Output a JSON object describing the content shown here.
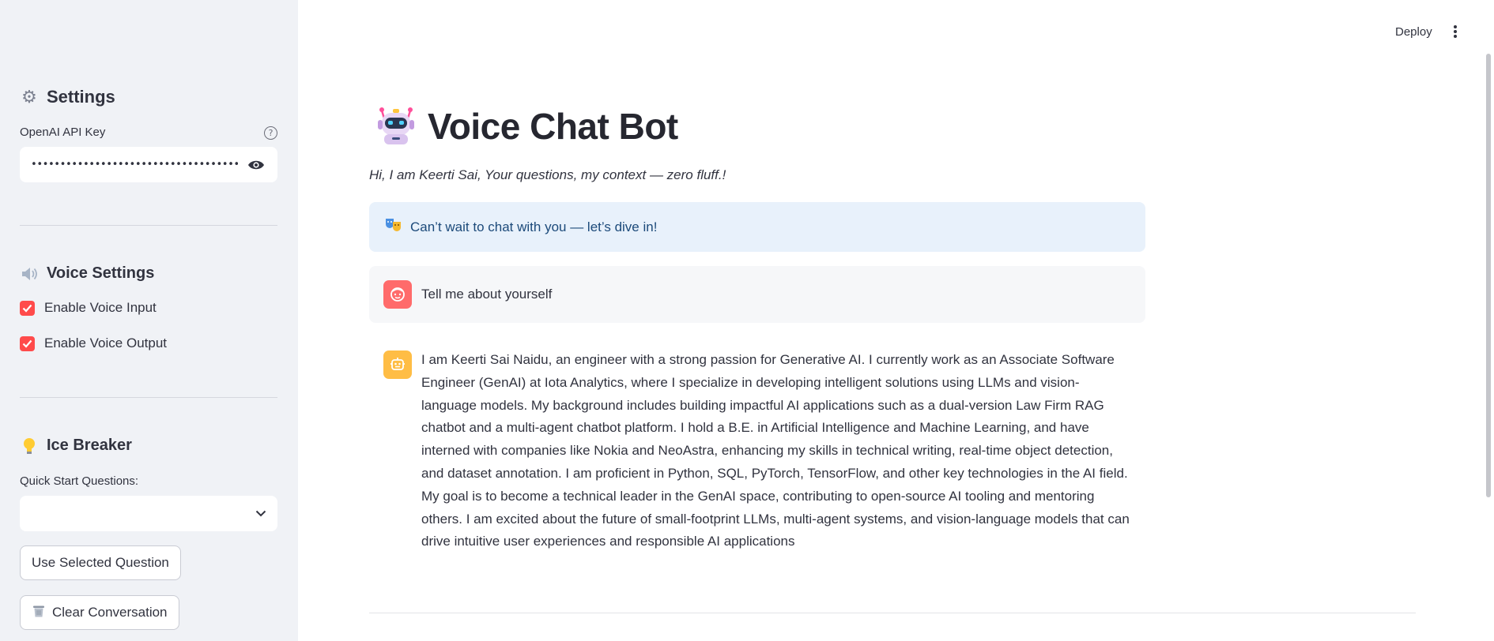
{
  "header": {
    "deploy_label": "Deploy",
    "menu_icon": "vertical-dots-icon"
  },
  "sidebar": {
    "settings": {
      "icon": "gear-icon",
      "title": "Settings",
      "api_key_label": "OpenAI API Key",
      "api_key_value": "••••••••••••••••••••••••••••••••••••••••••••••••",
      "help_icon": "help-circle-icon",
      "eye_icon": "eye-icon"
    },
    "voice": {
      "icon": "speaker-icon",
      "title": "Voice Settings",
      "enable_input_label": "Enable Voice Input",
      "enable_input_checked": true,
      "enable_output_label": "Enable Voice Output",
      "enable_output_checked": true
    },
    "ice_breaker": {
      "icon": "lightbulb-icon",
      "title": "Ice Breaker",
      "quick_start_label": "Quick Start Questions:",
      "selected_value": "",
      "use_selected_label": "Use Selected Question",
      "clear_label": "Clear Conversation",
      "clear_icon": "trash-icon"
    }
  },
  "main": {
    "title_icon": "robot-icon",
    "title": "Voice Chat Bot",
    "subtitle": "Hi, I am Keerti Sai, Your questions, my context — zero fluff.!",
    "info_icon": "masks-icon",
    "info_text": "Can’t wait to chat with you — let’s dive in!",
    "messages": [
      {
        "role": "user",
        "avatar_icon": "user-face-icon",
        "text": "Tell me about yourself"
      },
      {
        "role": "assistant",
        "avatar_icon": "bot-face-icon",
        "text": "I am Keerti Sai Naidu, an engineer with a strong passion for Generative AI. I currently work as an Associate Software Engineer (GenAI) at Iota Analytics, where I specialize in developing intelligent solutions using LLMs and vision-language models. My background includes building impactful AI applications such as a dual-version Law Firm RAG chatbot and a multi-agent chatbot platform. I hold a B.E. in Artificial Intelligence and Machine Learning, and have interned with companies like Nokia and NeoAstra, enhancing my skills in technical writing, real-time object detection, and dataset annotation. I am proficient in Python, SQL, PyTorch, TensorFlow, and other key technologies in the AI field. My goal is to become a technical leader in the GenAI space, contributing to open-source AI tooling and mentoring others. I am excited about the future of small-footprint LLMs, multi-agent systems, and vision-language models that can drive intuitive user experiences and responsible AI applications"
      }
    ]
  },
  "colors": {
    "accent": "#ff4b4b",
    "sidebar_bg": "#f0f2f6",
    "info_bg": "#e8f1fb",
    "info_text": "#1c4a7a",
    "bot_avatar": "#ffbd45"
  }
}
